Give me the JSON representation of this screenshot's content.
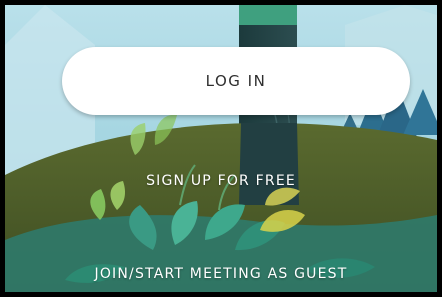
{
  "buttons": {
    "login_label": "LOG IN",
    "signup_label": "SIGN UP FOR FREE",
    "guest_label": "JOIN/START MEETING AS GUEST"
  },
  "colors": {
    "sky": "#9fd3e0",
    "hill": "#4f5f2b",
    "tree_trunk": "#223f42",
    "pine": "#2c6e8e",
    "button_bg": "#ffffff",
    "button_text": "#2e2e2e",
    "link_text": "#ffffff"
  }
}
